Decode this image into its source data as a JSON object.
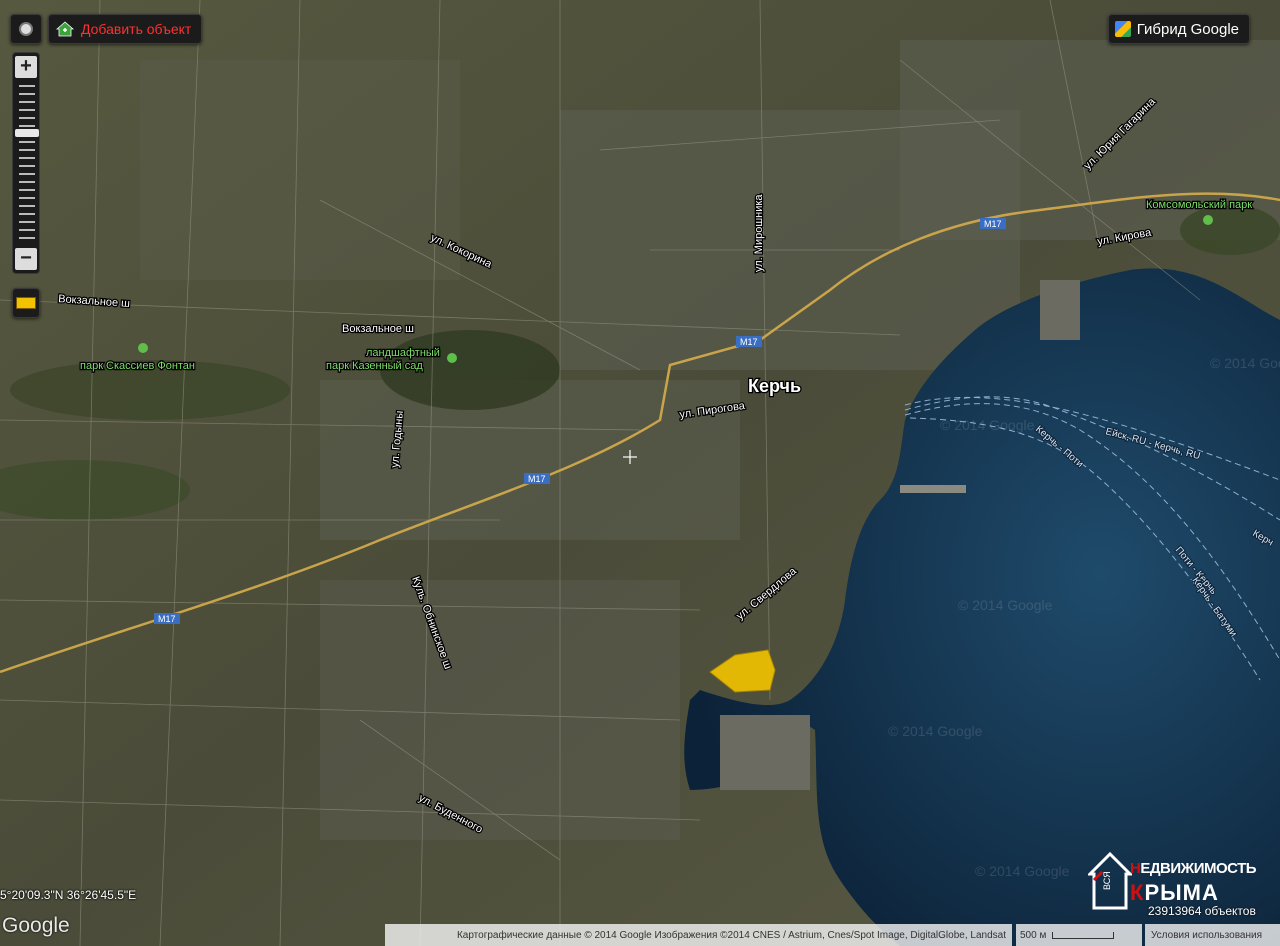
{
  "controls": {
    "add_object": "Добавить объект",
    "map_type": "Гибрид Google"
  },
  "map": {
    "city": "Керчь",
    "streets": [
      "ул. Кокорина",
      "Вокзальное ш",
      "Вокзальное ш",
      "ул. Мирошника",
      "ул. Юрия Гагарина",
      "ул. Кирова",
      "ул. Пирогова",
      "ул. Годыны",
      "Куль. Обнинское ш",
      "ул. Свердлова",
      "ул. Буденного"
    ],
    "parks": [
      "парк Скассиев Фонтан",
      "ландшафтный\nпарк Казенный сад",
      "Комсомольский парк"
    ],
    "highway_labels": [
      "M17",
      "M17",
      "M17",
      "M17"
    ],
    "ferry_routes": [
      "Ейск, RU - Керчь, RU",
      "Керчь - Поти",
      "Поти - Керчь",
      "Керчь - Батуми",
      "Керч"
    ],
    "watermarks": [
      "© 2014 Google",
      "© 2014 Google",
      "© 2014 Google",
      "© 2014 Google",
      "© 2014 Google"
    ]
  },
  "coordinates": "5°20'09.3\"N 36°26'45.5\"E",
  "google_logo": "Google",
  "attribution": "Картографические данные © 2014 Google Изображения ©2014 CNES / Astrium, Cnes/Spot Image, DigitalGlobe, Landsat",
  "scale_label": "500 м",
  "terms": "Условия использования",
  "brand": {
    "line1_prefix": "",
    "line1_big": "Н",
    "line1_rest": "ЕДВИЖИМОСТЬ",
    "line2_big": "К",
    "line2_rest": "РЫМА",
    "vse": "ВСЯ"
  },
  "objects_count": "23913964 объектов",
  "colors": {
    "sea": "#0f2c45",
    "land": "#4a4d3a",
    "highway": "#c9a44a",
    "highlight": "#f2c400",
    "accent_red": "#ff3030"
  }
}
